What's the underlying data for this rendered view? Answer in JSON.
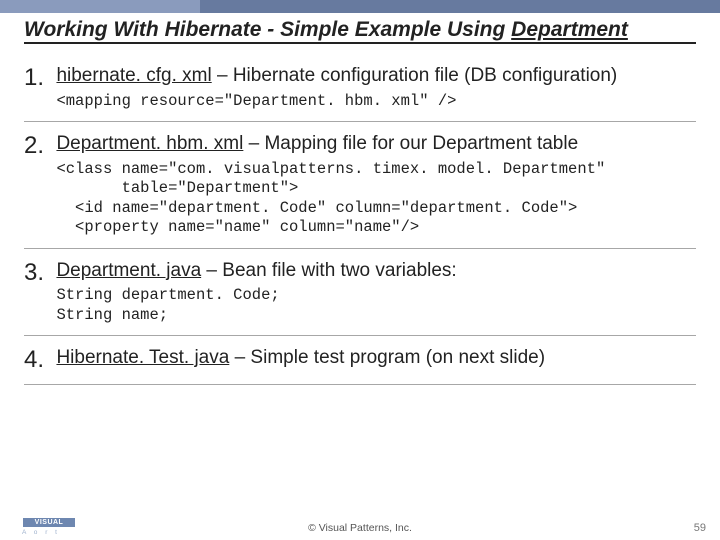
{
  "title_prefix": "Working With Hibernate - Simple Example Using ",
  "title_underlined": "Department",
  "items": [
    {
      "num": "1.",
      "file": "hibernate. cfg. xml",
      "rest": " – Hibernate configuration file (DB configuration)",
      "code": "<mapping resource=\"Department. hbm. xml\" />"
    },
    {
      "num": "2.",
      "file": "Department. hbm. xml",
      "rest": " – Mapping file for our Department table",
      "code": "<class name=\"com. visualpatterns. timex. model. Department\"\n       table=\"Department\">\n  <id name=\"department. Code\" column=\"department. Code\">\n  <property name=\"name\" column=\"name\"/>"
    },
    {
      "num": "3.",
      "file": "Department. java",
      "rest": " – Bean file with two variables:",
      "code": "String department. Code;\nString name;"
    },
    {
      "num": "4.",
      "file": "Hibernate. Test. java",
      "rest": " – Simple test program (on next slide)",
      "code": ""
    }
  ],
  "footer": "© Visual Patterns, Inc.",
  "pagenum": "59",
  "logo_top": "VISUAL",
  "logo_bot": "A o r t"
}
